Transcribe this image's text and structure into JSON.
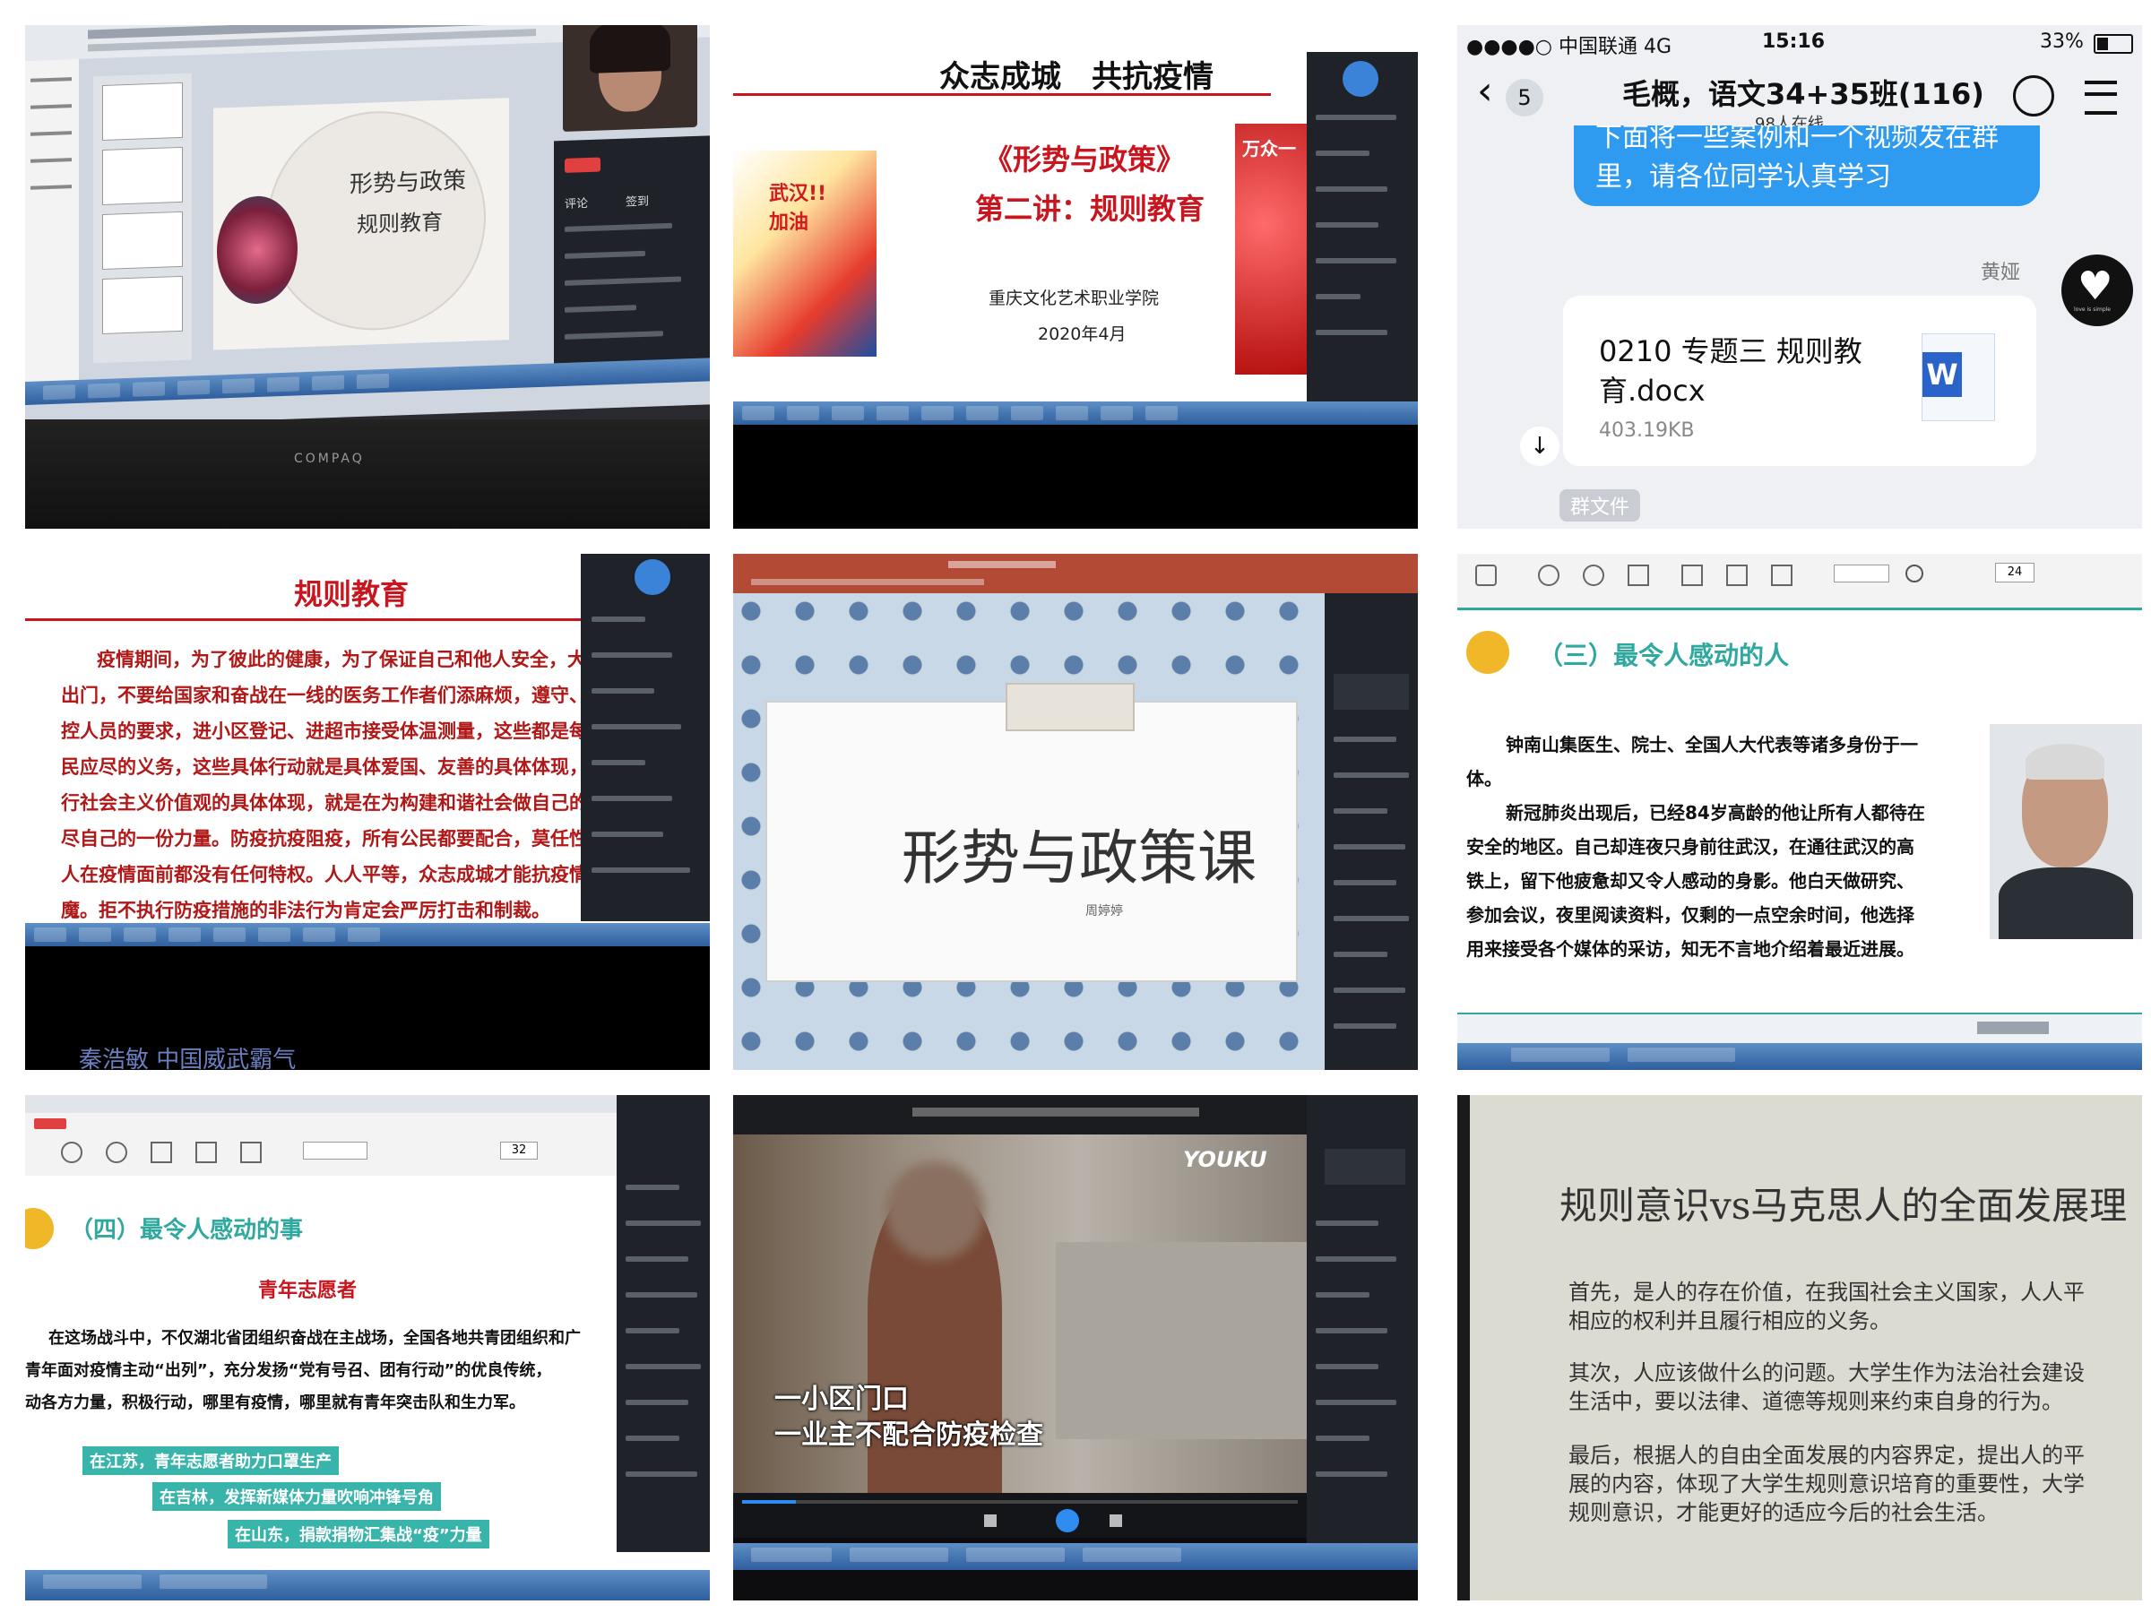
{
  "tile1": {
    "slide_line1": "形势与政策",
    "slide_line2": "规则教育",
    "laptop_brand": "COMPAQ",
    "panel_tabs": [
      "评论",
      "签到"
    ]
  },
  "tile2": {
    "header": "众志成城　共抗疫情",
    "course_title": "《形势与政策》",
    "lecture": "第二讲：规则教育",
    "school": "重庆文化艺术职业学院",
    "date": "2020年4月",
    "poster_text": "武汉!!加油",
    "banner_text": "万众一"
  },
  "tile3": {
    "carrier": "●●●●○ 中国联通  4G",
    "time": "15:16",
    "battery": "33%",
    "back_count": "5",
    "chat_title": "毛概，语文34+35班(116)",
    "online": "98人在线",
    "bubble_text": "下面将一些案例和一个视频发在群里，请各位同学认真学习",
    "sender": "黄娅",
    "file_name": "0210 专题三 规则教育.docx",
    "file_size": "403.19KB",
    "file_icon_letter": "W",
    "group_file_label": "群文件",
    "avatar_text": "love is simple"
  },
  "tile4": {
    "title": "规则教育",
    "lines": [
      "疫情期间，为了彼此的健康，为了保证自己和他人安全，大",
      "出门，不要给国家和奋战在一线的医务工作者们添麻烦，遵守、",
      "控人员的要求，进小区登记、进超市接受体温测量，这些都是每",
      "民应尽的义务，这些具体行动就是具体爱国、友善的具体体现，",
      "行社会主义价值观的具体体现，就是在为构建和谐社会做自己的",
      "尽自己的一份力量。防疫抗疫阻疫，所有公民都要配合，莫任性",
      "人在疫情面前都没有任何特权。人人平等，众志成城才能抗疫情",
      "魔。拒不执行防疫措施的非法行为肯定会严厉打击和制裁。"
    ],
    "caption": "秦浩敏 中国威武霸气"
  },
  "tile5": {
    "slide_title": "形势与政策课",
    "presenter": "周婷婷"
  },
  "tile6": {
    "page_input": "24",
    "heading": "（三）最令人感动的人",
    "lines": [
      "钟南山集医生、院士、全国人大代表等诸多身份于一",
      "体。",
      "新冠肺炎出现后，已经84岁高龄的他让所有人都待在",
      "安全的地区。自己却连夜只身前往武汉，在通往武汉的高",
      "铁上，留下他疲惫却又令人感动的身影。他白天做研究、",
      "参加会议，夜里阅读资料，仅剩的一点空余时间，他选择",
      "用来接受各个媒体的采访，知无不言地介绍着最近进展。"
    ]
  },
  "tile7": {
    "page_input": "32",
    "heading": "（四）最令人感动的事",
    "subheading": "青年志愿者",
    "lines": [
      "在这场战斗中，不仅湖北省团组织奋战在主战场，全国各地共青团组织和广",
      "青年面对疫情主动“出列”，充分发扬“党有号召、团有行动”的优良传统，",
      "动各方力量，积极行动，哪里有疫情，哪里就有青年突击队和生力军。"
    ],
    "tags": [
      "在江苏，青年志愿者助力口罩生产",
      "在吉林，发挥新媒体力量吹响冲锋号角",
      "在山东，捐款捐物汇集战“疫”力量"
    ]
  },
  "tile8": {
    "logo": "YOUKU",
    "subtitle1": "一小区门口",
    "subtitle2": "一业主不配合防疫检查"
  },
  "tile9": {
    "title": "规则意识vs马克思人的全面发展理",
    "p1a": "首先，是人的存在价值，在我国社会主义国家，人人平",
    "p1b": "相应的权利并且履行相应的义务。",
    "p2a": "其次，人应该做什么的问题。大学生作为法治社会建设",
    "p2b": "生活中，要以法律、道德等规则来约束自身的行为。",
    "p3a": "最后，根据人的自由全面发展的内容界定，提出人的平",
    "p3b": "展的内容，体现了大学生规则意识培育的重要性，大学",
    "p3c": "规则意识，才能更好的适应今后的社会生活。"
  }
}
